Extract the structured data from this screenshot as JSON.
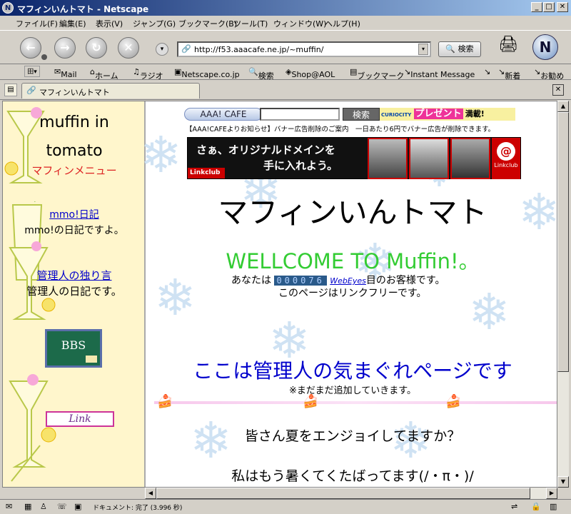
{
  "window": {
    "title": "マフィンいんトマト - Netscape",
    "app_icon": "N"
  },
  "menu": [
    "ファイル(F)",
    "編集(E)",
    "表示(V)",
    "ジャンプ(G)",
    "ブックマーク(B)",
    "ツール(T)",
    "ウィンドウ(W)",
    "ヘルプ(H)"
  ],
  "nav": {
    "url": "http://f53.aaacafe.ne.jp/~muffin/",
    "search_label": "検索"
  },
  "personal": [
    "Mail",
    "ホーム",
    "ラジオ",
    "Netscape.co.jp",
    "検索",
    "Shop@AOL",
    "ブックマーク",
    "Instant Message",
    "新着",
    "お勧め"
  ],
  "tab": {
    "title": "マフィンいんトマト"
  },
  "ad": {
    "brand": "AAA! CAFE",
    "search_btn": "検索",
    "curiocity": "CURIOCITY",
    "present": "プレゼント",
    "present_suffix": "満載!",
    "notice": "【AAA!CAFEよりお知らせ】バナー広告削除のご案内　一日あたり6円でバナー広告が削除できます。",
    "banner_line1": "さぁ、オリジナルドメインを",
    "banner_line2": "手に入れよう。",
    "banner_brand": "Linkclub",
    "banner_brand2": "Linkclub"
  },
  "sidebar": {
    "site_title_1": "muffin in",
    "site_title_2": "tomato",
    "menu_heading": "マフィンメニュー",
    "link1": "mmo!日記",
    "link1_desc": "mmo!の日記ですよ。",
    "link2": "管理人の独り言",
    "link2_desc": "管理人の日記です。",
    "bbs": "BBS",
    "link_ribbon": "Link"
  },
  "main": {
    "title": "マフィンいんトマト",
    "welcome": "WELLCOME TO Muffin!。",
    "visitor_prefix": "あなたは",
    "counter": "000076",
    "counter_brand": "WebEyes",
    "visitor_suffix": "目のお客様です。",
    "linkfree": "このページはリンクフリーです。",
    "heading2": "ここは管理人の気まぐれページです",
    "note": "※まだまだ追加していきます。",
    "msg1": "皆さん夏をエンジョイしてますか？",
    "msg2": "私はもう暑くてくたばってます(/・π・)/"
  },
  "status": {
    "text": "ドキュメント: 完了 (3.996 秒)"
  },
  "colors": {
    "welcome": "#33cc33",
    "heading2": "#0000cc",
    "menu_heading": "#dd2222",
    "sidebar_bg": "#fff6cc",
    "link": "#0000cc"
  }
}
